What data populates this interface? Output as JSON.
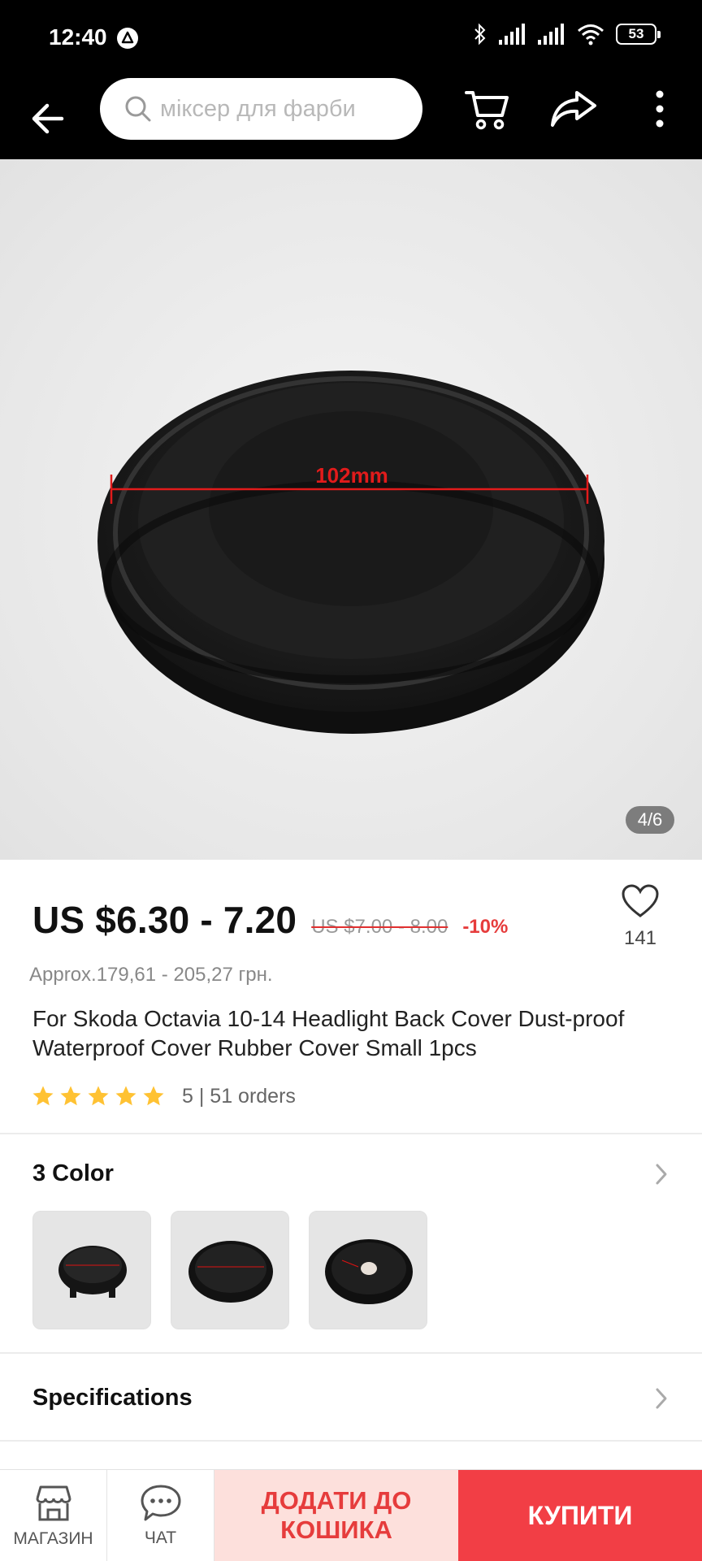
{
  "status_bar": {
    "time": "12:40",
    "battery": "53"
  },
  "search": {
    "placeholder": "міксер для фарби"
  },
  "gallery": {
    "counter": "4/6",
    "dimension_label": "102mm"
  },
  "price": {
    "current": "US $6.30 - 7.20",
    "original": "US $7.00 - 8.00",
    "discount": "-10%",
    "approx": "Approx.179,61 - 205,27 грн."
  },
  "wishlist": {
    "count": "141"
  },
  "product": {
    "title": "For Skoda Octavia 10-14 Headlight Back Cover Dust-proof Waterproof Cover Rubber Cover Small 1pcs",
    "rating_stars": 5,
    "rating_text": "5 | 51 orders"
  },
  "variants": {
    "title": "3 Color",
    "count": 3
  },
  "specifications": {
    "title": "Specifications"
  },
  "bottom_bar": {
    "store_label": "МАГАЗИН",
    "chat_label": "ЧАТ",
    "add_to_cart": "ДОДАТИ ДО КОШИКА",
    "buy": "КУПИТИ"
  },
  "colors": {
    "accent": "#f23e45",
    "discount": "#e63c3c",
    "star": "#ffc233",
    "cart_bg": "#fde0dc"
  }
}
